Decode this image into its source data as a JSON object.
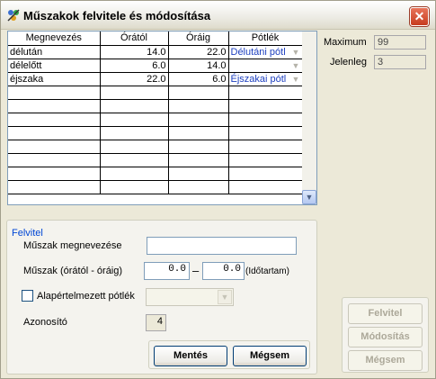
{
  "window": {
    "title": "Műszakok felvitele és módosítása",
    "close": "✕"
  },
  "grid": {
    "columns": [
      "Megnevezés",
      "Órától",
      "Óráig",
      "Pótlék"
    ],
    "rows": [
      [
        "délután",
        "14.0",
        "22.0",
        "Délutáni pótl"
      ],
      [
        "délelőtt",
        "6.0",
        "14.0",
        ""
      ],
      [
        "éjszaka",
        "22.0",
        "6.0",
        "Éjszakai pótl"
      ]
    ]
  },
  "info": {
    "max_label": "Maximum",
    "max_value": "99",
    "now_label": "Jelenleg",
    "now_value": "3"
  },
  "form": {
    "group_title": "Felvitel",
    "name_label": "Műszak megnevezése",
    "name_value": "",
    "range_label": "Műszak (órától - óráig)",
    "from_value": "0.0",
    "dash": "–",
    "to_value": "0.0",
    "duration_label": "(Időtartam)",
    "default_label": "Alapértelmezett pótlék",
    "default_value": "",
    "id_label": "Azonosító",
    "id_value": "4",
    "save": "Mentés",
    "cancel": "Mégsem"
  },
  "side": {
    "add": "Felvitel",
    "edit": "Módosítás",
    "cancel": "Mégsem"
  },
  "colors": {
    "accent": "#0046d5",
    "selection_text": "#1d3fbf"
  }
}
